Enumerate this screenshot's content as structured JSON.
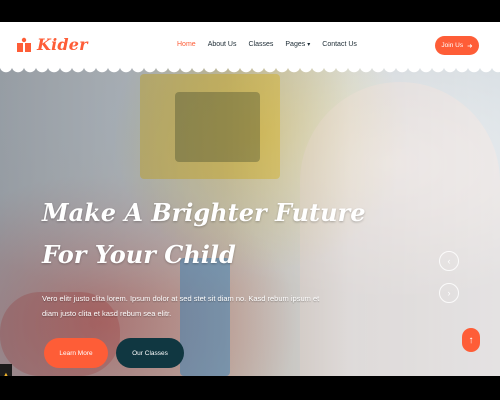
{
  "brand": {
    "name": "Kider",
    "logo_icon": "book-shelf-icon"
  },
  "nav": {
    "items": [
      {
        "label": "Home",
        "active": true
      },
      {
        "label": "About Us",
        "active": false
      },
      {
        "label": "Classes",
        "active": false
      },
      {
        "label": "Pages",
        "active": false,
        "dropdown": true
      },
      {
        "label": "Contact Us",
        "active": false
      }
    ]
  },
  "cta": {
    "join_label": "Join Us",
    "join_icon": "arrow-right-icon"
  },
  "hero": {
    "title_line1": "Make A Brighter Future",
    "title_line2": "For Your Child",
    "description": "Vero elitr justo clita lorem. Ipsum dolor at sed stet sit diam no. Kasd rebum ipsum et diam justo clita et kasd rebum sea elitr.",
    "learn_more_label": "Learn More",
    "our_classes_label": "Our Classes"
  },
  "carousel": {
    "prev_icon": "chevron-left-icon",
    "next_icon": "chevron-right-icon"
  },
  "back_to_top_icon": "arrow-up-icon",
  "colors": {
    "primary": "#fe5d37",
    "dark": "#103741",
    "text": "#1b2a33"
  }
}
